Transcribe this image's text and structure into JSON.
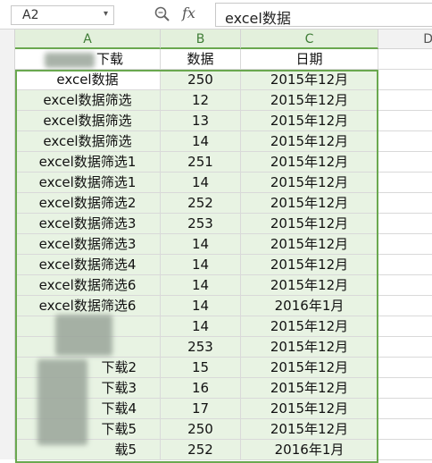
{
  "formula_bar": {
    "cell_ref": "A2",
    "fx_label": "fx",
    "formula": "excel数据"
  },
  "columns": [
    "A",
    "B",
    "C",
    "D"
  ],
  "header": {
    "a": "下载",
    "b": "数据",
    "c": "日期"
  },
  "rows": [
    {
      "a": "excel数据",
      "b": "250",
      "c": "2015年12月"
    },
    {
      "a": "excel数据筛选",
      "b": "12",
      "c": "2015年12月"
    },
    {
      "a": "excel数据筛选",
      "b": "13",
      "c": "2015年12月"
    },
    {
      "a": "excel数据筛选",
      "b": "14",
      "c": "2015年12月"
    },
    {
      "a": "excel数据筛选1",
      "b": "251",
      "c": "2015年12月"
    },
    {
      "a": "excel数据筛选1",
      "b": "14",
      "c": "2015年12月"
    },
    {
      "a": "excel数据筛选2",
      "b": "252",
      "c": "2015年12月"
    },
    {
      "a": "excel数据筛选3",
      "b": "253",
      "c": "2015年12月"
    },
    {
      "a": "excel数据筛选3",
      "b": "14",
      "c": "2015年12月"
    },
    {
      "a": "excel数据筛选4",
      "b": "14",
      "c": "2015年12月"
    },
    {
      "a": "excel数据筛选6",
      "b": "14",
      "c": "2015年12月"
    },
    {
      "a": "excel数据筛选6",
      "b": "14",
      "c": "2016年1月"
    },
    {
      "a": "",
      "b": "14",
      "c": "2015年12月"
    },
    {
      "a": "",
      "b": "253",
      "c": "2015年12月"
    },
    {
      "a": "下载2",
      "b": "15",
      "c": "2015年12月"
    },
    {
      "a": "下载3",
      "b": "16",
      "c": "2015年12月"
    },
    {
      "a": "下载4",
      "b": "17",
      "c": "2015年12月"
    },
    {
      "a": "下载5",
      "b": "250",
      "c": "2015年12月"
    },
    {
      "a": "载5",
      "b": "252",
      "c": "2016年1月"
    }
  ]
}
